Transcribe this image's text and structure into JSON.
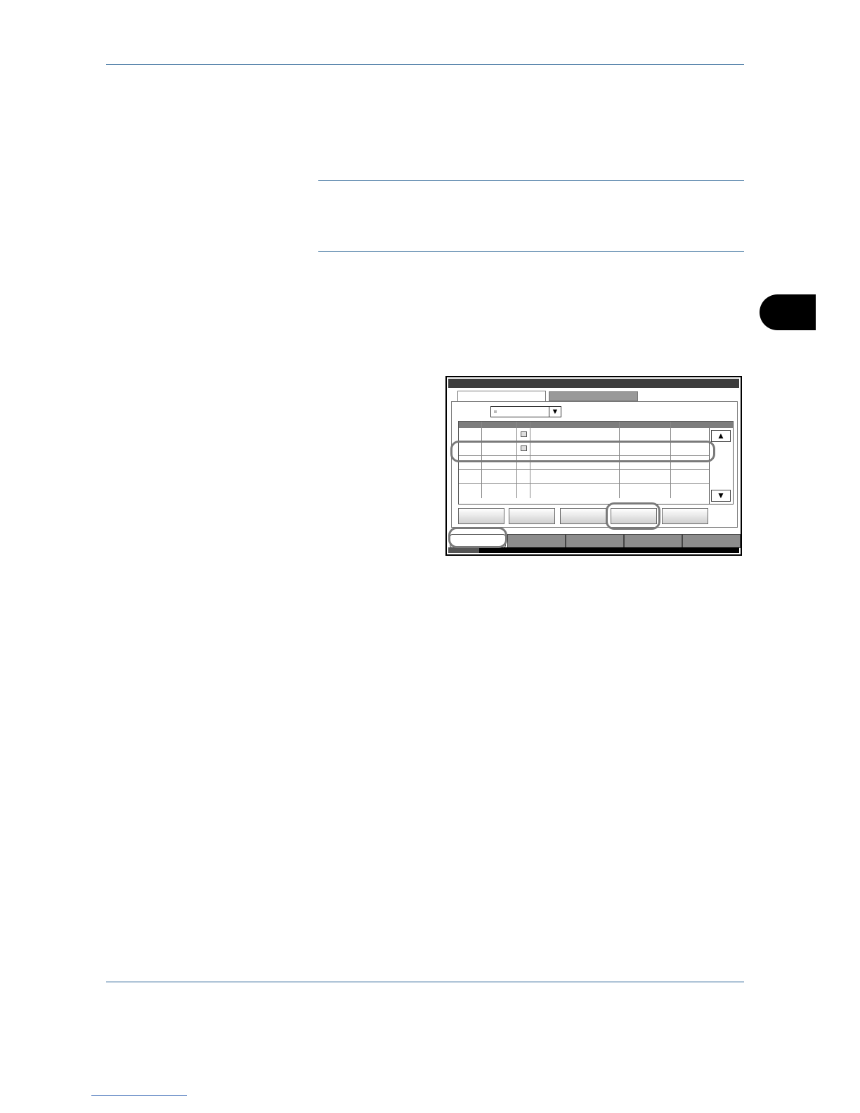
{
  "page": {
    "header_rule": "",
    "note": ""
  },
  "panel_screen": {
    "up_arrow": "▲",
    "down_arrow": "▼",
    "dropdown_arrow": "▼"
  },
  "colors": {
    "rule": "#1f5b8f",
    "chapter_tab": "#000000",
    "highlight": "#7a7a7a"
  },
  "icons": [
    "fax-job-icon",
    "scroll-up-icon",
    "scroll-down-icon",
    "dropdown-arrow-icon"
  ]
}
